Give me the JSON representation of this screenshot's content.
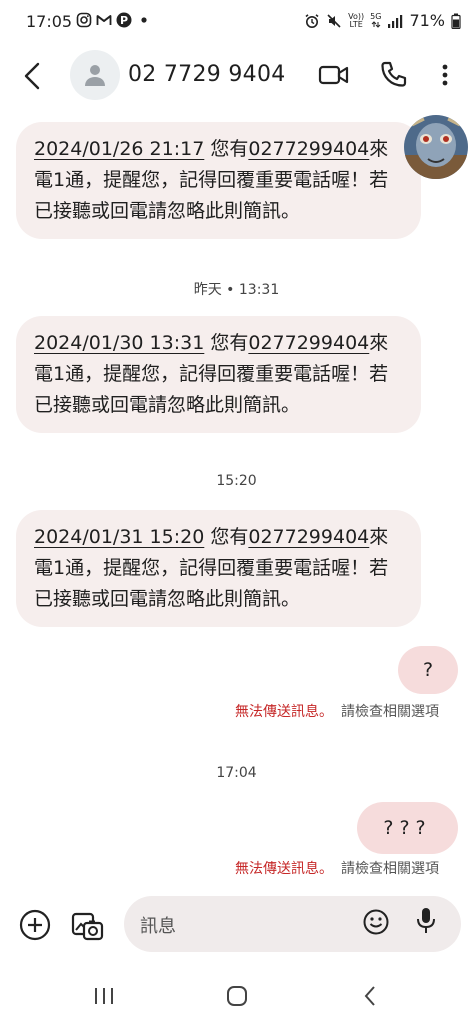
{
  "status_bar": {
    "time": "17:05",
    "battery": "71%",
    "network": "5G",
    "volte_top": "Vo))",
    "volte_bottom": "LTE",
    "icons": [
      "instagram-icon",
      "gmail-icon",
      "parking-icon",
      "dot-icon",
      "alarm-icon",
      "mute-icon",
      "volte-icon",
      "5g-icon",
      "signal-icon",
      "battery-icon"
    ]
  },
  "header": {
    "contact_name": "02 7729 9404",
    "icons": [
      "back-arrow-icon",
      "contact-avatar-icon",
      "video-call-icon",
      "phone-call-icon",
      "more-vert-icon"
    ]
  },
  "messages": [
    {
      "direction": "incoming",
      "date_link": "2024/01/26 21:17",
      "text_a": " 您有",
      "number_link": "0277299404",
      "text_b": "來電1通，提醒您，記得回覆重要電話喔！若已接聽或回電請忽略此則簡訊。"
    },
    {
      "direction": "incoming",
      "date_link": "2024/01/30 13:31",
      "text_a": " 您有",
      "number_link": "0277299404",
      "text_b": "來電1通，提醒您，記得回覆重要電話喔！若已接聽或回電請忽略此則簡訊。"
    },
    {
      "direction": "incoming",
      "date_link": "2024/01/31 15:20",
      "text_a": " 您有",
      "number_link": "0277299404",
      "text_b": "來電1通，提醒您，記得回覆重要電話喔！若已接聽或回電請忽略此則簡訊。"
    },
    {
      "direction": "outgoing",
      "text": "?"
    },
    {
      "direction": "outgoing",
      "text": "???"
    }
  ],
  "separators": [
    "昨天 • 13:31",
    "15:20",
    "17:04"
  ],
  "failure": {
    "failed_text": "無法傳送訊息。",
    "check_text": "請檢查相關選項"
  },
  "compose": {
    "placeholder": "訊息",
    "icons": [
      "add-circle-icon",
      "gallery-icon",
      "emoji-icon",
      "mic-icon"
    ]
  },
  "nav": {
    "icons": [
      "recent-apps-icon",
      "home-icon",
      "nav-back-icon"
    ]
  },
  "colors": {
    "incoming_bubble": "#f6eeed",
    "outgoing_bubble": "#f6dcdc",
    "error_red": "#c62828"
  }
}
